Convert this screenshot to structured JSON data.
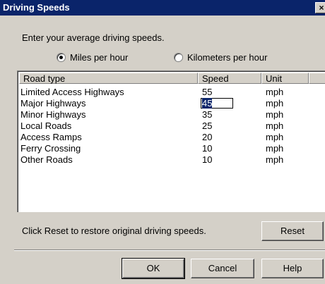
{
  "window": {
    "title": "Driving Speeds",
    "close_label": "×"
  },
  "prompt": "Enter your average driving speeds.",
  "units_options": [
    {
      "label": "Miles per hour",
      "selected": true
    },
    {
      "label": "Kilometers per hour",
      "selected": false
    }
  ],
  "table": {
    "columns": [
      "Road type",
      "Speed",
      "Unit"
    ],
    "rows": [
      {
        "road": "Limited Access Highways",
        "speed": "55",
        "unit": "mph"
      },
      {
        "road": "Major Highways",
        "speed": "45",
        "unit": "mph"
      },
      {
        "road": "Minor Highways",
        "speed": "35",
        "unit": "mph"
      },
      {
        "road": "Local Roads",
        "speed": "25",
        "unit": "mph"
      },
      {
        "road": "Access Ramps",
        "speed": "20",
        "unit": "mph"
      },
      {
        "road": "Ferry Crossing",
        "speed": "10",
        "unit": "mph"
      },
      {
        "road": "Other Roads",
        "speed": "10",
        "unit": "mph"
      }
    ],
    "editing": {
      "row": 1,
      "value": "45"
    }
  },
  "reset_hint": "Click Reset to restore original driving speeds.",
  "buttons": {
    "reset": "Reset",
    "ok": "OK",
    "cancel": "Cancel",
    "help": "Help"
  },
  "colors": {
    "titlebar": "#0a246a",
    "face": "#d4d0c8",
    "selection": "#0a246a"
  }
}
